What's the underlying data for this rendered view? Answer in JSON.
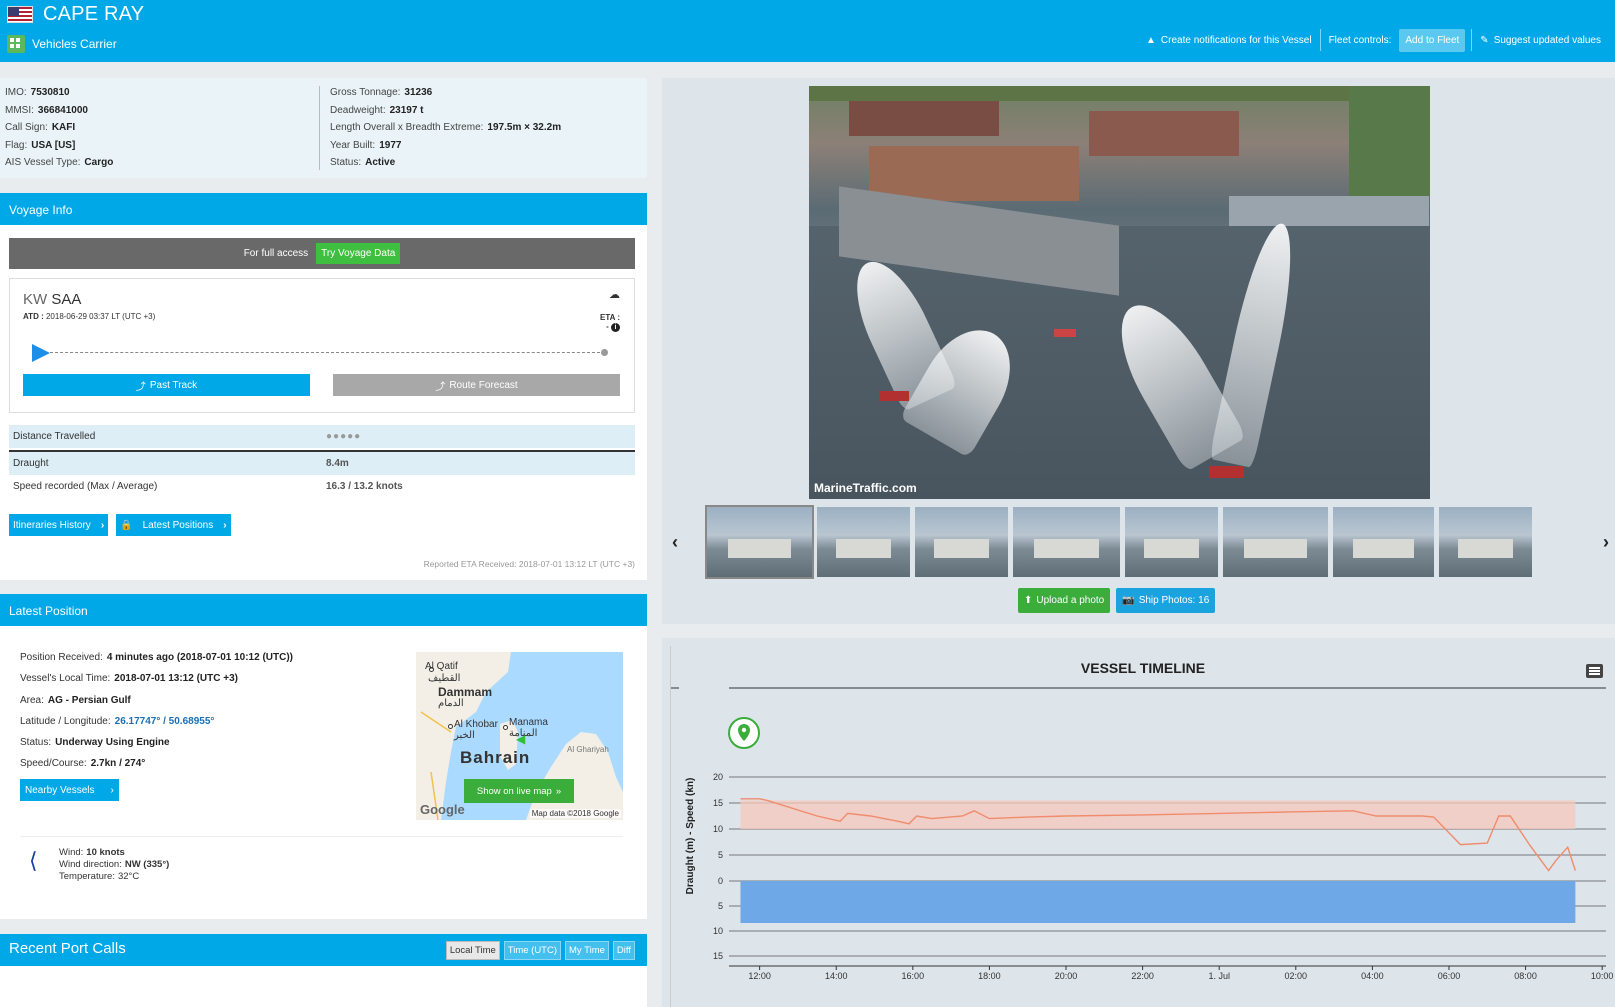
{
  "header": {
    "vessel_name": "CAPE RAY",
    "vessel_type": "Vehicles Carrier",
    "create_notifications": "Create notifications for this Vessel",
    "fleet_controls": "Fleet controls:",
    "add_to_fleet": "Add to Fleet",
    "suggest_values": "Suggest updated values"
  },
  "particulars": {
    "left": [
      {
        "label": "IMO:",
        "value": "7530810"
      },
      {
        "label": "MMSI:",
        "value": "366841000"
      },
      {
        "label": "Call Sign:",
        "value": "KAFI"
      },
      {
        "label": "Flag:",
        "value": "USA [US]"
      },
      {
        "label": "AIS Vessel Type:",
        "value": "Cargo"
      }
    ],
    "right": [
      {
        "label": "Gross Tonnage:",
        "value": "31236"
      },
      {
        "label": "Deadweight:",
        "value": "23197 t"
      },
      {
        "label": "Length Overall x Breadth Extreme:",
        "value": "197.5m × 32.2m"
      },
      {
        "label": "Year Built:",
        "value": "1977"
      },
      {
        "label": "Status:",
        "value": "Active"
      }
    ]
  },
  "voyage": {
    "title": "Voyage Info",
    "full_access": "For full access",
    "try_voyage": "Try Voyage Data",
    "origin_country": "KW",
    "origin_port": "SAA",
    "atd_label": "ATD :",
    "atd_value": "2018-06-29 03:37 LT (UTC +3)",
    "eta_label": "ETA :",
    "eta_value": "-",
    "past_track": "Past Track",
    "route_forecast": "Route Forecast",
    "distance_label": "Distance Travelled",
    "distance_value": "●●●●●",
    "draught_label": "Draught",
    "draught_value": "8.4m",
    "speed_label": "Speed recorded (Max / Average)",
    "speed_value": "16.3 / 13.2 knots",
    "itineraries": "Itineraries History",
    "latest_positions": "Latest Positions",
    "reported_eta": "Reported ETA Received: 2018-07-01 13:12 LT (UTC +3)"
  },
  "latest_position": {
    "title": "Latest Position",
    "rows": [
      {
        "label": "Position Received:",
        "value": "4 minutes ago (2018-07-01 10:12 (UTC))"
      },
      {
        "label": "Vessel's Local Time:",
        "value": "2018-07-01 13:12 (UTC +3)"
      },
      {
        "label": "Area:",
        "value": "AG - Persian Gulf"
      },
      {
        "label": "Latitude / Longitude:",
        "value": "26.17747° / 50.68955°"
      },
      {
        "label": "Status:",
        "value": "Underway Using Engine"
      },
      {
        "label": "Speed/Course:",
        "value": "2.7kn / 274°"
      }
    ],
    "nearby": "Nearby Vessels",
    "map": {
      "labels": [
        "Al Qatif",
        "القطيف",
        "Dammam",
        "الدمام",
        "Al Khobar",
        "الخبر",
        "Manama",
        "المنامة",
        "Bahrain",
        "Al Ghariyah",
        "Google",
        "Map data ©2018 Google"
      ],
      "show_live": "Show on live map"
    },
    "wind_label": "Wind:",
    "wind_value": "10  knots",
    "wind_dir_label": "Wind direction:",
    "wind_dir_value": "NW (335°)",
    "temp_label": "Temperature:",
    "temp_value": "32°C"
  },
  "port_calls": {
    "title": "Recent Port Calls",
    "buttons": [
      "Local Time",
      "Time (UTC)",
      "My Time",
      "Diff"
    ]
  },
  "photos": {
    "watermark": "MarineTraffic.com",
    "upload": "Upload a photo",
    "ship_photos": "Ship Photos: 16",
    "thumbnail_count": 8
  },
  "timeline": {
    "title": "VESSEL TIMELINE",
    "ylabel": "Draught (m) - Speed (kn)",
    "yticks_upper": [
      "20",
      "15",
      "10",
      "5",
      "0"
    ],
    "yticks_lower": [
      "5",
      "10",
      "15"
    ],
    "xticks": [
      "12:00",
      "14:00",
      "16:00",
      "18:00",
      "20:00",
      "22:00",
      "1. Jul",
      "02:00",
      "04:00",
      "06:00",
      "08:00",
      "10:00"
    ]
  },
  "chart_data": {
    "type": "line",
    "title": "VESSEL TIMELINE",
    "ylabel": "Draught (m) - Speed (kn)",
    "x_hours": [
      11.5,
      12.0,
      12.2,
      13.5,
      14.1,
      14.3,
      14.9,
      15.6,
      15.9,
      16.1,
      16.5,
      17.3,
      17.6,
      18.0,
      19.0,
      20.0,
      22.0,
      24.0,
      26.0,
      27.5,
      28.1,
      29.3,
      29.6,
      30.3,
      31.0,
      31.3,
      31.6,
      32.1,
      32.2,
      32.6,
      32.8,
      33.1,
      33.3
    ],
    "speed": [
      15.8,
      15.8,
      15.5,
      12.5,
      11.5,
      13.0,
      12.5,
      11.5,
      11.0,
      12.5,
      12.0,
      12.5,
      13.5,
      12.0,
      12.3,
      12.5,
      12.7,
      13.0,
      13.3,
      13.5,
      12.5,
      12.5,
      12.3,
      7.0,
      7.3,
      12.5,
      12.5,
      7.0,
      6.0,
      2.0,
      4.0,
      6.5,
      2.0
    ],
    "draught": 8.4,
    "speed_band": [
      10,
      15.5
    ],
    "ylim_upper": [
      0,
      20
    ],
    "ylim_lower": [
      0,
      15
    ],
    "xlim_hours": [
      11.2,
      34.1
    ]
  },
  "colors": {
    "brand": "#00a8e8",
    "green": "#3aad3a",
    "speed_line": "#f08c6c",
    "speed_band": "#f5c8bc",
    "draught_fill": "#6ea8e6"
  }
}
